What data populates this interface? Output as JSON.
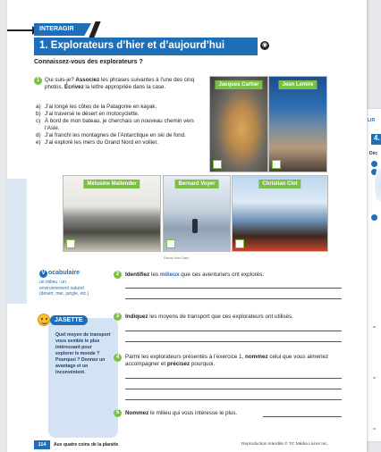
{
  "tab": "INTERAGIR",
  "back_page": {
    "tab": "LIR",
    "number": "4.",
    "dec": "Déc",
    "q1": "1",
    "q2": "2"
  },
  "title": "1. Explorateurs d’hier et d’aujourd’hui",
  "subtitle": "Connaissez-vous des explorateurs ?",
  "q1": {
    "num": "1",
    "text_a": "Qui suis-je? ",
    "bold_1": "Associez",
    "text_b": " les phrases suivantes à l’une des cinq photos. ",
    "bold_2": "Écrivez",
    "text_c": " la lettre appropriée dans la case.",
    "items": [
      {
        "letter": "a)",
        "text": "J’ai longé les côtes de la Patagonie en kayak."
      },
      {
        "letter": "b)",
        "text": "J’ai traversé le désert en motocyclette."
      },
      {
        "letter": "c)",
        "text": "À bord de mon bateau, je cherchais un nouveau chemin vers l’Asie."
      },
      {
        "letter": "d)",
        "text": "J’ai franchi les montagnes de l’Antarctique en ski de fond."
      },
      {
        "letter": "e)",
        "text": "J’ai exploré les mers du Grand Nord en voilier."
      }
    ]
  },
  "photos": [
    {
      "caption": "Jacques Cartier"
    },
    {
      "caption": "Jean Lemire"
    },
    {
      "caption": "Mélusine Mallender"
    },
    {
      "caption": "Bernard Voyer"
    },
    {
      "caption": "Christian Clot"
    }
  ],
  "photo_credit": "Pascal Jean-Saint",
  "vocab": {
    "title": "ocabulaire",
    "term": "un milieu : un environnement naturel (désert, mer, jungle, etc.)"
  },
  "jasette": {
    "title": "JASETTE",
    "text": "Quel moyen de transport vous semble le plus intéressant pour explorer le monde ? Pourquoi ? Donnez un avantage et un inconvénient."
  },
  "q2": {
    "num": "2",
    "bold": "Identifiez",
    "mid": " les ",
    "hl": "milieux",
    "rest": " que ces aventuriers ont explorés."
  },
  "q3": {
    "num": "3",
    "bold": "Indiquez",
    "rest": " les moyens de transport que ces explorateurs ont utilisés."
  },
  "q4": {
    "num": "4",
    "a": "Parmi les explorateurs présentés à l’exercice 1, ",
    "bold1": "nommez",
    "b": " celui que vous aimeriez accompagner et ",
    "bold2": "précisez",
    "c": " pourquoi."
  },
  "q5": {
    "num": "5",
    "bold": "Nommez",
    "rest": " le milieu qui vous intéresse le plus."
  },
  "footer": {
    "page": "114",
    "title": "Aux quatre coins de la planète",
    "copyright": "Reproduction interdite © TC Média Livres Inc."
  }
}
